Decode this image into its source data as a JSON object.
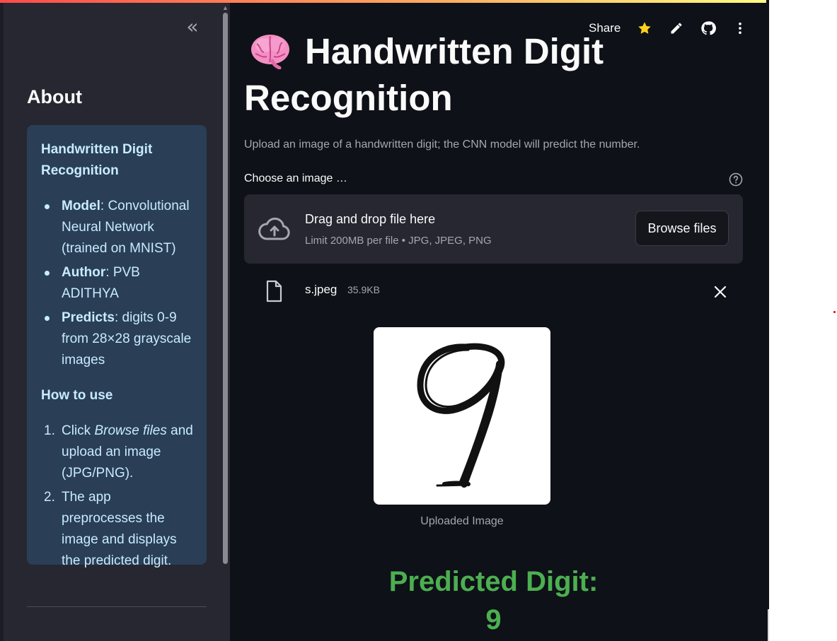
{
  "sidebar": {
    "collapse_icon": "double-chevron-left",
    "heading": "About",
    "about": {
      "app_title": "Handwritten Digit Recognition",
      "details": [
        {
          "label": "Model",
          "text": ": Convolutional Neural Network (trained on MNIST)"
        },
        {
          "label": "Author",
          "text": ": PVB ADITHYA"
        },
        {
          "label": "Predicts",
          "text": ": digits 0-9 from 28×28 grayscale images"
        }
      ],
      "howto_title": "How to use",
      "steps": [
        {
          "num": "1.",
          "before": "Click ",
          "em": "Browse files",
          "after": " and upload an image (JPG/PNG)."
        },
        {
          "num": "2.",
          "before": "The app preprocesses the image and displays the predicted digit.",
          "em": "",
          "after": ""
        }
      ]
    }
  },
  "header": {
    "share_label": "Share",
    "icons": [
      "star-icon",
      "pencil-icon",
      "github-icon",
      "more-vertical-icon"
    ]
  },
  "main": {
    "title": "Handwritten Digit Recognition",
    "title_emoji": "brain-emoji",
    "subtitle": "Upload an image of a handwritten digit; the CNN model will predict the number.",
    "uploader": {
      "label": "Choose an image …",
      "drag_text": "Drag and drop file here",
      "limit_text": "Limit 200MB per file • JPG, JPEG, PNG",
      "browse_label": "Browse files"
    },
    "file": {
      "name": "s.jpeg",
      "size": "35.9KB"
    },
    "image_caption": "Uploaded Image",
    "prediction_label": "Predicted Digit:",
    "prediction_value": "9"
  },
  "colors": {
    "background": "#0e1117",
    "sidebar": "#262730",
    "info_box": "#2a3e56",
    "info_text": "#c7ebff",
    "prediction": "#4caf50",
    "star": "#ffd31a"
  }
}
